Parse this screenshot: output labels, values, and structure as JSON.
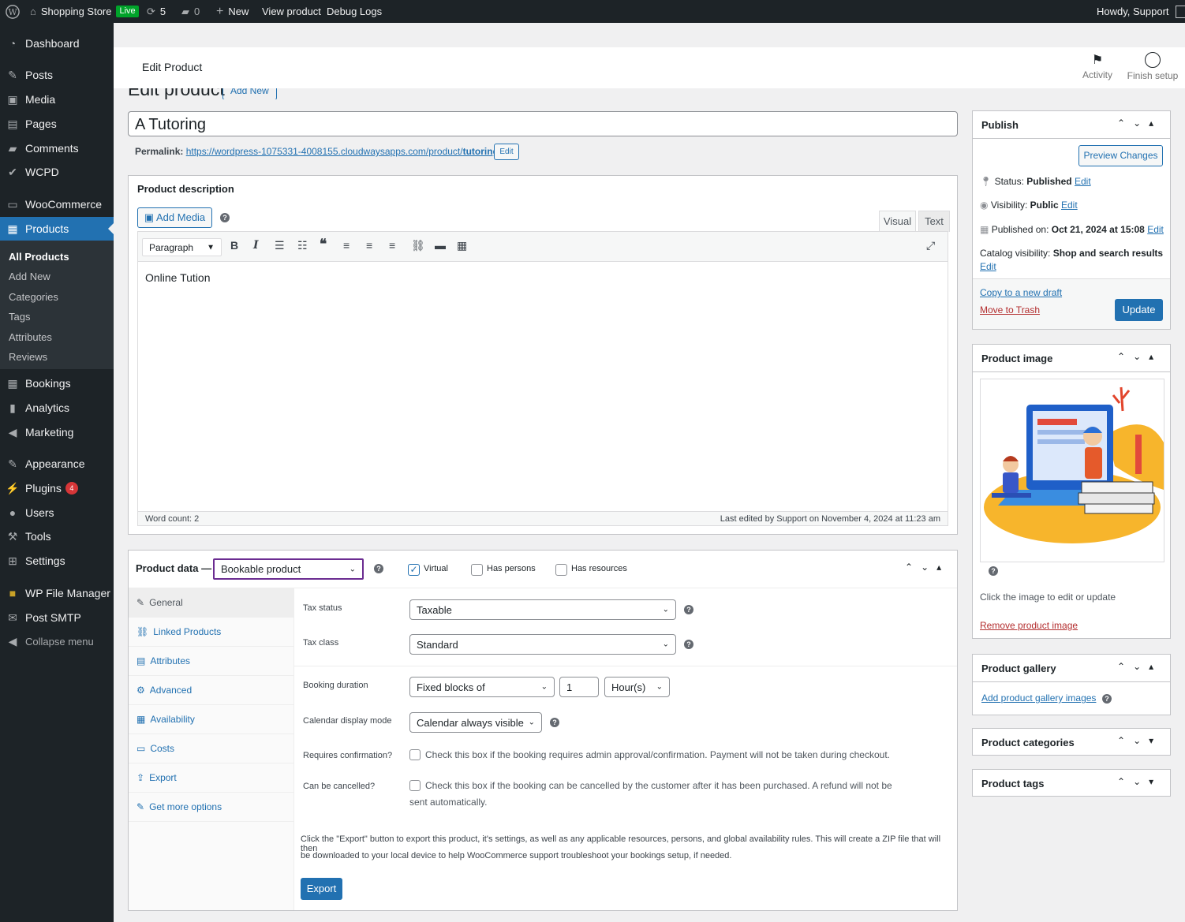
{
  "adminbar": {
    "site": "Shopping Store",
    "live": "Live",
    "updates": "5",
    "comments": "0",
    "new": "New",
    "view": "View product",
    "debug": "Debug Logs",
    "howdy": "Howdy, Support"
  },
  "menu": {
    "dashboard": "Dashboard",
    "posts": "Posts",
    "media": "Media",
    "pages": "Pages",
    "comments": "Comments",
    "wcpd": "WCPD",
    "woocommerce": "WooCommerce",
    "products": "Products",
    "bookings": "Bookings",
    "analytics": "Analytics",
    "marketing": "Marketing",
    "appearance": "Appearance",
    "plugins": "Plugins",
    "plugins_badge": "4",
    "users": "Users",
    "tools": "Tools",
    "settings": "Settings",
    "wpfm": "WP File Manager",
    "smtp": "Post SMTP",
    "collapse": "Collapse menu"
  },
  "submenu": {
    "all": "All Products",
    "add": "Add New",
    "categories": "Categories",
    "tags": "Tags",
    "attributes": "Attributes",
    "reviews": "Reviews"
  },
  "header": {
    "title": "Edit Product",
    "activity": "Activity",
    "finish": "Finish setup"
  },
  "page": {
    "heading": "Edit product",
    "add_new": "Add New",
    "product_title": "A Tutoring",
    "permalink_label": "Permalink:",
    "permalink_base": "https://wordpress-1075331-4008155.cloudwaysapps.com/product/",
    "permalink_slug": "tutoring",
    "permalink_end": "/",
    "permalink_edit": "Edit"
  },
  "description": {
    "title": "Product description",
    "add_media": "Add Media",
    "visual": "Visual",
    "text": "Text",
    "paragraph": "Paragraph",
    "content": "Online Tution",
    "word_count": "Word count: 2",
    "last_edited": "Last edited by Support on November 4, 2024 at 11:23 am"
  },
  "product_data": {
    "label": "Product data —",
    "type": "Bookable product",
    "virtual": "Virtual",
    "has_persons": "Has persons",
    "has_resources": "Has resources",
    "tabs": [
      "General",
      "Linked Products",
      "Attributes",
      "Advanced",
      "Availability",
      "Costs",
      "Export",
      "Get more options"
    ],
    "tax_status_label": "Tax status",
    "tax_status": "Taxable",
    "tax_class_label": "Tax class",
    "tax_class": "Standard",
    "duration_label": "Booking duration",
    "duration_type": "Fixed blocks of",
    "duration_value": "1",
    "duration_unit": "Hour(s)",
    "calendar_label": "Calendar display mode",
    "calendar": "Calendar always visible",
    "confirm_label": "Requires confirmation?",
    "confirm_text": "Check this box if the booking requires admin approval/confirmation. Payment will not be taken during checkout.",
    "cancel_label": "Can be cancelled?",
    "cancel_text1": "Check this box if the booking can be cancelled by the customer after it has been purchased. A refund will not be",
    "cancel_text2": "sent automatically.",
    "export_text1": "Click the \"Export\" button to export this product, it's settings, as well as any applicable resources, persons, and global availability rules. This will create a ZIP file that will then",
    "export_text2": "be downloaded to your local device to help WooCommerce support troubleshoot your bookings setup, if needed.",
    "export_btn": "Export"
  },
  "publish": {
    "title": "Publish",
    "preview": "Preview Changes",
    "status_label": "Status:",
    "status": "Published",
    "visibility_label": "Visibility:",
    "visibility": "Public",
    "published_label": "Published on:",
    "published": "Oct 21, 2024 at 15:08",
    "catalog_label": "Catalog visibility:",
    "catalog": "Shop and search results",
    "edit": "Edit",
    "copy": "Copy to a new draft",
    "trash": "Move to Trash",
    "update": "Update"
  },
  "image_box": {
    "title": "Product image",
    "hint": "Click the image to edit or update",
    "remove": "Remove product image"
  },
  "gallery": {
    "title": "Product gallery",
    "add": "Add product gallery images"
  },
  "categories": {
    "title": "Product categories"
  },
  "tags": {
    "title": "Product tags"
  },
  "colors": {
    "accent": "#2271b1",
    "dark": "#1d2327",
    "highlight": "#6b2c91",
    "live": "#00a32a",
    "danger": "#b32d2e"
  }
}
